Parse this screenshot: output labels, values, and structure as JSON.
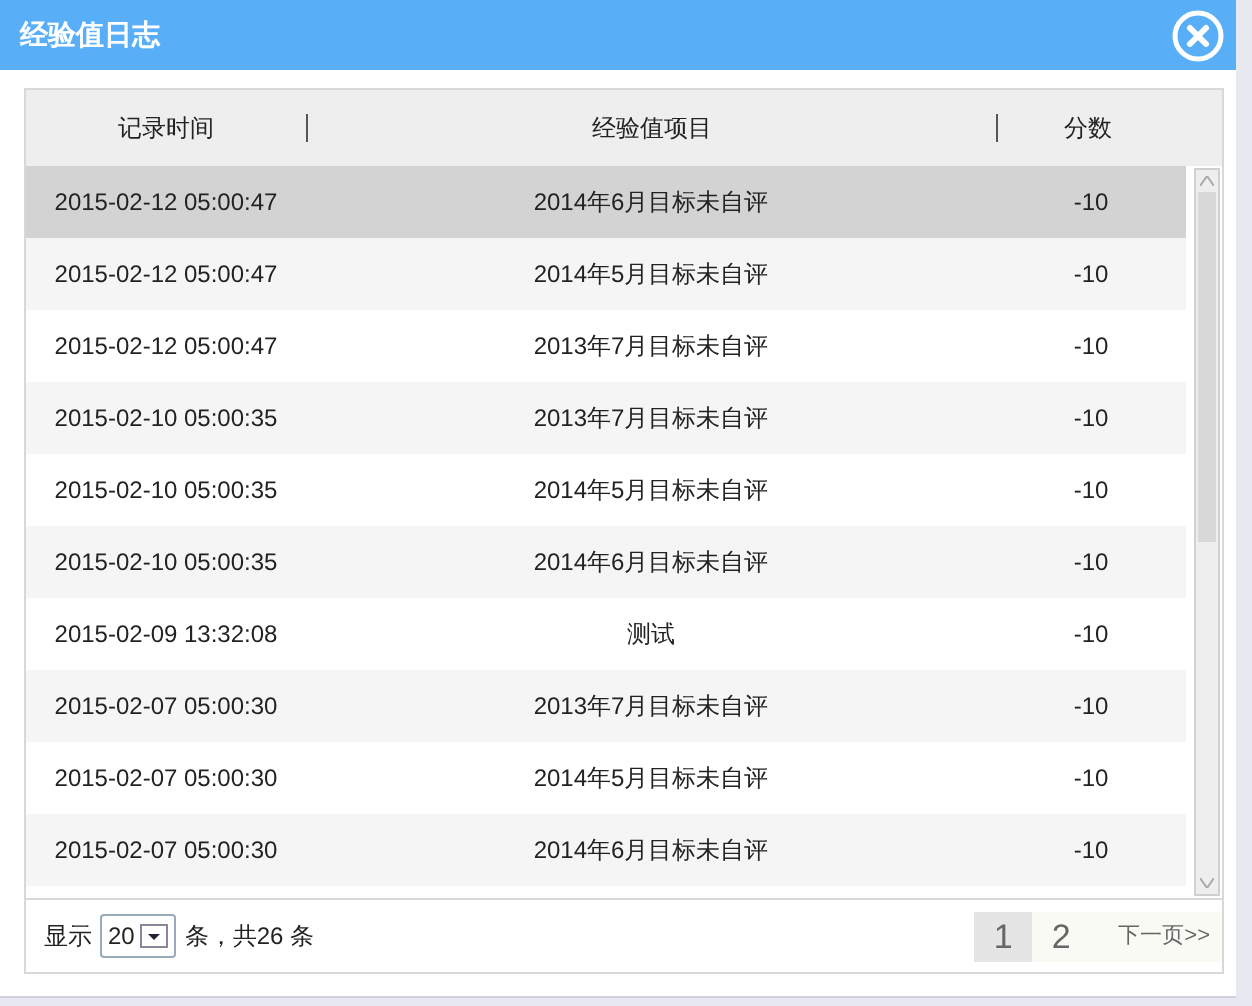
{
  "window": {
    "title": "经验值日志"
  },
  "table": {
    "columns": [
      "记录时间",
      "经验值项目",
      "分数"
    ],
    "rows": [
      {
        "time": "2015-02-12 05:00:47",
        "item": "2014年6月目标未自评",
        "score": "-10",
        "selected": true
      },
      {
        "time": "2015-02-12 05:00:47",
        "item": "2014年5月目标未自评",
        "score": "-10",
        "selected": false
      },
      {
        "time": "2015-02-12 05:00:47",
        "item": "2013年7月目标未自评",
        "score": "-10",
        "selected": false
      },
      {
        "time": "2015-02-10 05:00:35",
        "item": "2013年7月目标未自评",
        "score": "-10",
        "selected": false
      },
      {
        "time": "2015-02-10 05:00:35",
        "item": "2014年5月目标未自评",
        "score": "-10",
        "selected": false
      },
      {
        "time": "2015-02-10 05:00:35",
        "item": "2014年6月目标未自评",
        "score": "-10",
        "selected": false
      },
      {
        "time": "2015-02-09 13:32:08",
        "item": "测试",
        "score": "-10",
        "selected": false
      },
      {
        "time": "2015-02-07 05:00:30",
        "item": "2013年7月目标未自评",
        "score": "-10",
        "selected": false
      },
      {
        "time": "2015-02-07 05:00:30",
        "item": "2014年5月目标未自评",
        "score": "-10",
        "selected": false
      },
      {
        "time": "2015-02-07 05:00:30",
        "item": "2014年6月目标未自评",
        "score": "-10",
        "selected": false
      }
    ]
  },
  "footer": {
    "show_label": "显示",
    "page_size": "20",
    "total": "条，共26 条",
    "pages": [
      {
        "label": "1",
        "selected": true
      },
      {
        "label": "2",
        "selected": false
      }
    ],
    "next": "下一页>>"
  }
}
